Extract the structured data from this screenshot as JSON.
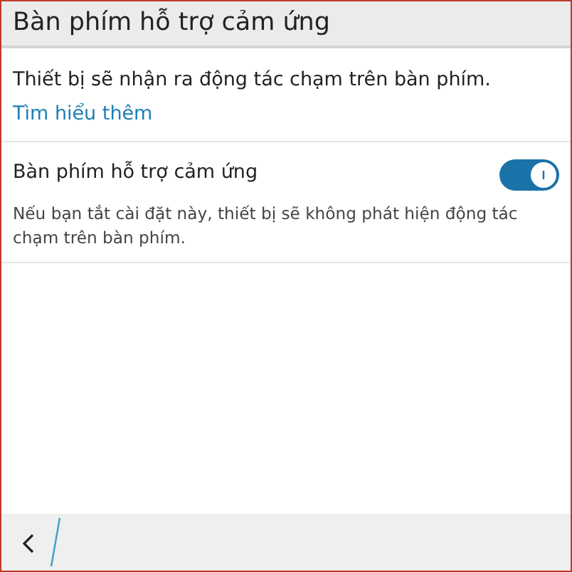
{
  "title": "Bàn phím hỗ trợ cảm ứng",
  "description": "Thiết bị sẽ nhận ra động tác chạm trên bàn phím.",
  "learn_more_link": "Tìm hiểu thêm",
  "setting": {
    "label": "Bàn phím hỗ trợ cảm ứng",
    "on": true,
    "note": "Nếu bạn tắt cài đặt này, thiết bị sẽ không phát hiện động tác chạm trên bàn phím."
  }
}
